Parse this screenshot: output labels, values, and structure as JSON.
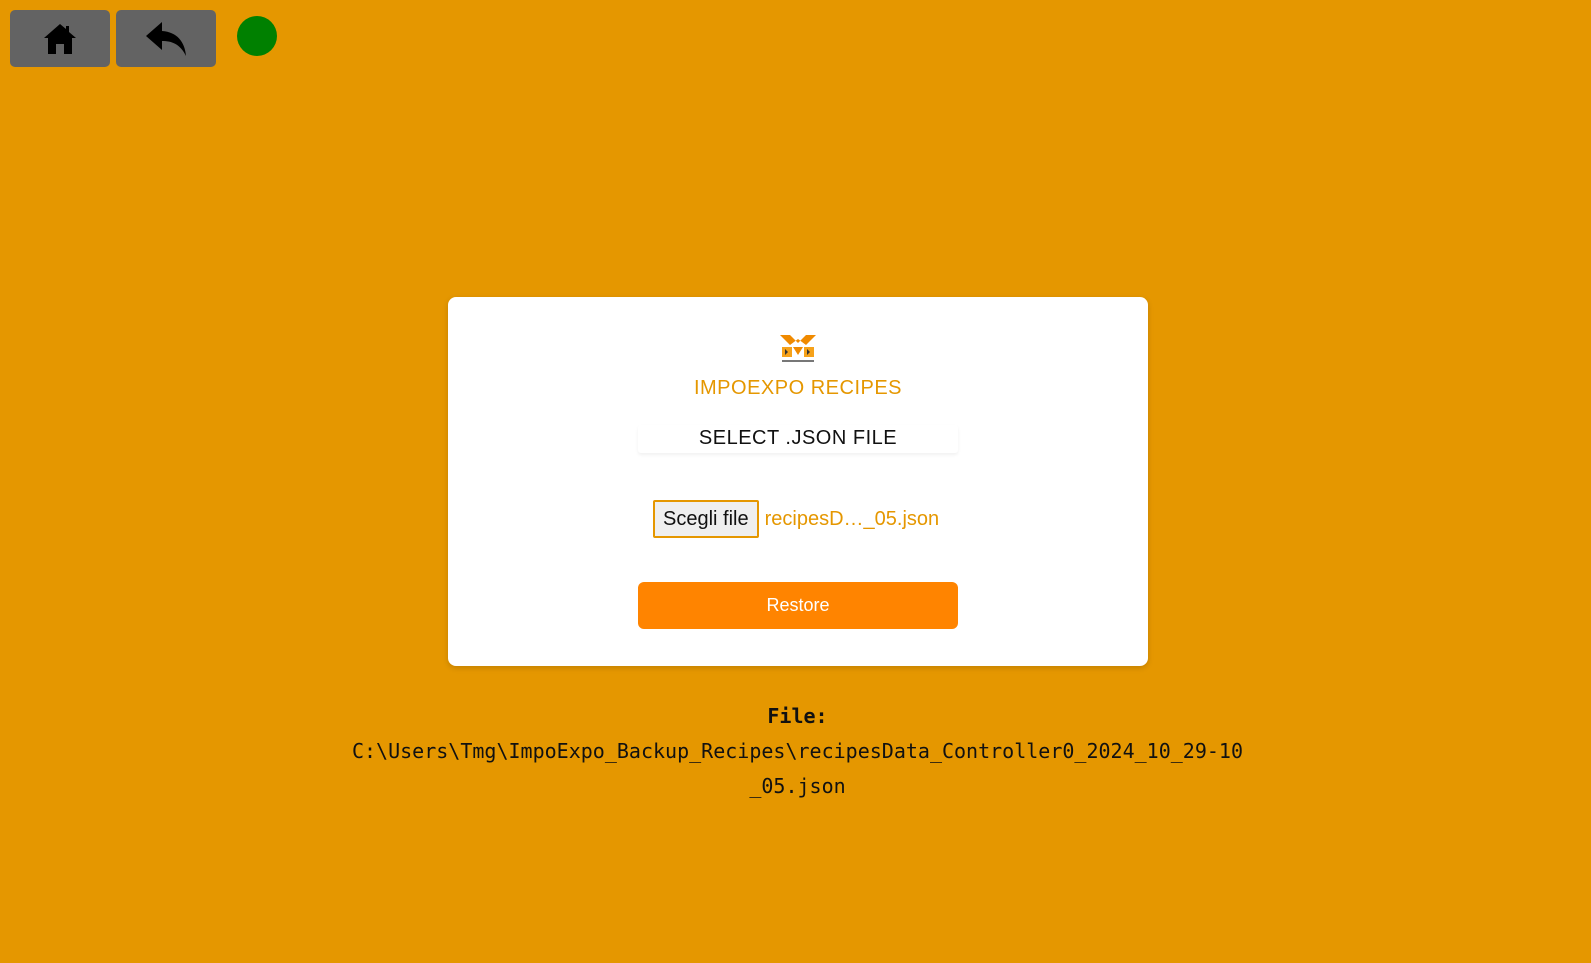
{
  "topbar": {
    "home_icon": "home-icon",
    "back_icon": "back-arrow-icon",
    "status_color": "#008000"
  },
  "colors": {
    "background": "#e59700",
    "accent": "#e59700",
    "button": "#ff8400",
    "nav_button": "#636363"
  },
  "card": {
    "logo_icon": "tmg-logo",
    "title": "IMPOEXPO RECIPES",
    "select_label": "SELECT .JSON FILE",
    "choose_button": "Scegli file",
    "file_name": "recipesD…_05.json",
    "restore_button": "Restore"
  },
  "file_info": {
    "label": "File:",
    "path": "C:\\Users\\Tmg\\ImpoExpo_Backup_Recipes\\recipesData_Controller0_2024_10_29-10_05.json"
  }
}
